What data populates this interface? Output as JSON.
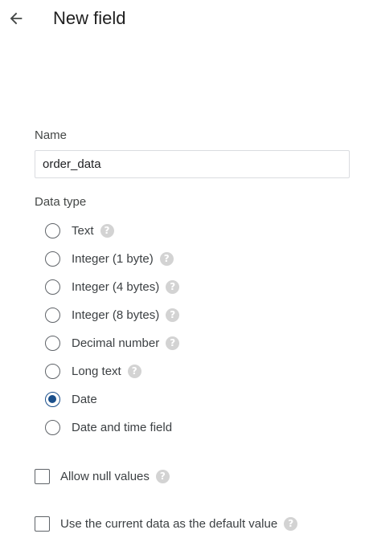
{
  "header": {
    "back_icon": "arrow-left-icon",
    "title": "New field"
  },
  "name_field": {
    "label": "Name",
    "value": "order_data"
  },
  "data_type": {
    "label": "Data type",
    "help_icon": "question-circle-icon",
    "options": [
      {
        "label": "Text",
        "checked": false,
        "help": true
      },
      {
        "label": "Integer (1 byte)",
        "checked": false,
        "help": true
      },
      {
        "label": "Integer (4 bytes)",
        "checked": false,
        "help": true
      },
      {
        "label": "Integer (8 bytes)",
        "checked": false,
        "help": true
      },
      {
        "label": "Decimal number",
        "checked": false,
        "help": true
      },
      {
        "label": "Long text",
        "checked": false,
        "help": true
      },
      {
        "label": "Date",
        "checked": true,
        "help": false
      },
      {
        "label": "Date and time field",
        "checked": false,
        "help": false
      }
    ]
  },
  "options": {
    "allow_null": {
      "label": "Allow null values",
      "checked": false
    },
    "use_current_default": {
      "label": "Use the current data as the default value",
      "checked": false
    }
  },
  "colors": {
    "accent": "#1a4f8b",
    "help_icon_bg": "#d3d3d3"
  }
}
